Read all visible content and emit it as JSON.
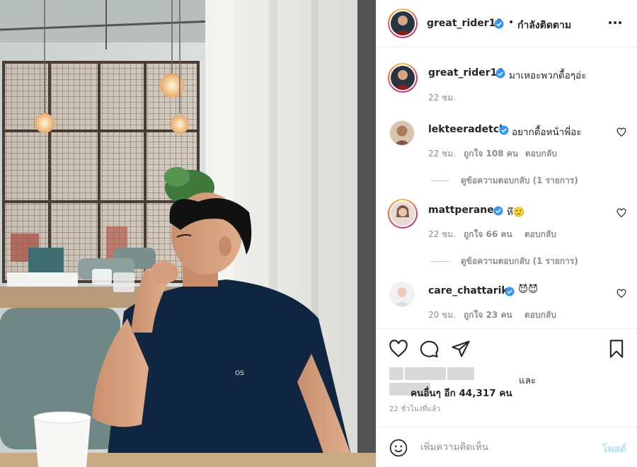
{
  "post": {
    "author": "great_rider10",
    "follow_separator": "•",
    "follow_status": "กำลังติดตาม",
    "caption_author": "great_rider10",
    "caption_text": "มาเหอะพวกตื้อๆอ่ะ",
    "caption_time": "22 ชม."
  },
  "comments": [
    {
      "username": "lekteeradetch",
      "text": "อยากตื้อหน้าพี่อะ",
      "time": "22 ชม.",
      "likes": "ถูกใจ 108 คน",
      "reply": "ตอบกลับ",
      "view_replies": "ดูข้อความตอบกลับ (1 รายการ)"
    },
    {
      "username": "mattperanee",
      "text": "หึ🙂",
      "time": "22 ชม.",
      "likes": "ถูกใจ 66 คน",
      "reply": "ตอบกลับ",
      "view_replies": "ดูข้อความตอบกลับ (1 รายการ)"
    },
    {
      "username": "care_chattarika",
      "text": "😈😈",
      "time": "20 ชม.",
      "likes": "ถูกใจ 23 คน",
      "reply": "ตอบกลับ"
    }
  ],
  "likes": {
    "and_text": "และ",
    "others_text": "คนอื่นๆ อีก 44,317 คน"
  },
  "time_ago": "22 ชั่วโมงที่แล้ว",
  "comment_box": {
    "placeholder": "เพิ่มความคิดเห็น",
    "post_label": "โพสต์"
  },
  "icons": {
    "more": "more-horizontal-icon",
    "like": "heart-outline-icon",
    "comment": "speech-bubble-icon",
    "share": "paper-plane-icon",
    "save": "bookmark-icon",
    "emoji": "smiley-icon",
    "verified": "verified-badge-icon"
  },
  "colors": {
    "verified_blue": "#3897f0",
    "muted_text": "#8e8e8e",
    "post_button_disabled": "#b2dffc",
    "ring_gradient_start": "#f9c23c",
    "ring_gradient_mid": "#e1306c"
  }
}
